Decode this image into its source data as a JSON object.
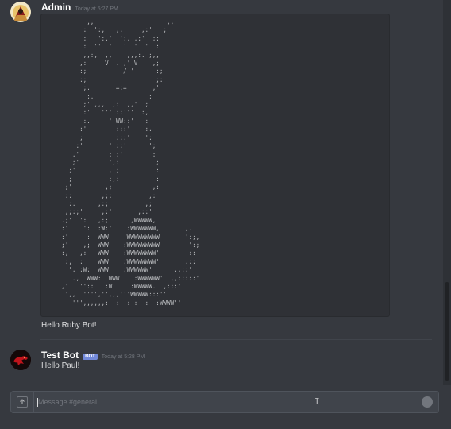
{
  "messages": [
    {
      "username": "Admin",
      "timestamp": "Today at 5:27 PM",
      "ascii_art": "         ,,                    ,,\n        :  ':,   ,,     ,:'   ;\n        :   ':.'  ':, ,:'  ;:\n        :  ''  '   '  '  '  :\n        ,,:,  ,,.   ,,,:. ;,,\n       ,:     V '. ,' V    ,;\n       :;          / '      :;\n       :;                   ;:\n        ;.       =:=       ,'\n         ;.               ;\n        ;' ,,,  ;:  ,,'  ;\n        :'   '''::;'''  :,\n        :.     ':WW::'   :\n       :'       ':::'    :.\n       ;        ':::'    ':\n      :'       ':::'      ';\n     ,'        ;::'        :\n     ;'        ';:          ;\n    ;'         ,:;          :\n    ;          :;:          :\n   ;'         ,;'          ,:\n   ::        ,;:          ,:\n    :.      ,:;          ,;\n   ,;:;'     ,:'       ,::'\n  .;'  ':   ,:;      ,WWWWW,\n  :'    ':  :W:'    :WWWWWWW,       ,.\n  :'     :  WWW     WWWWWWWWW       ':;,\n  ;'    ,;  WWW    :WWWWWWWWW        ':;\n  :,   ,:   WWW    :WWWWWWWW'        ::\n   :,  :    WWW    :WWWWWWWW'       .::\n    ', :W:  WWW    :WWWWWW'      ,,::'\n     .,  WWW:  WWW    :WWWWWW'  ,,:::::'\n  ,'   ''::   :W:    :WWWWW.  ,:::'\n   ',,  '''','',,,'''WWWWW:::''\n     ''',,,,,,:  :  : :  :  :WWWW''",
      "text": "Hello Ruby Bot!"
    },
    {
      "username": "Test Bot",
      "badge": "BOT",
      "timestamp": "Today at 5:28 PM",
      "text": "Hello Paul!"
    }
  ],
  "composer": {
    "placeholder": "Message #general"
  },
  "colors": {
    "background": "#36393f",
    "code_background": "#2f3136",
    "bot_badge": "#7289da"
  }
}
